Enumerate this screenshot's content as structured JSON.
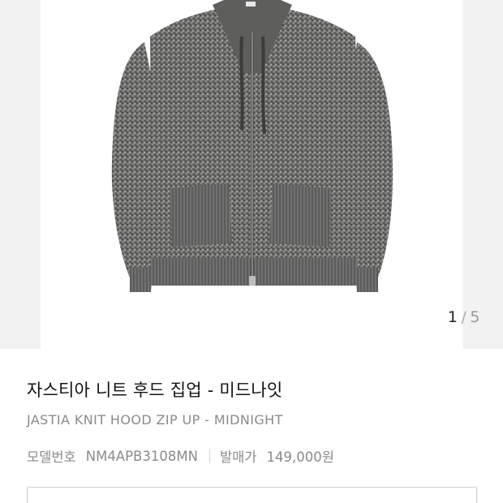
{
  "gallery": {
    "pager": {
      "current": "1",
      "separator": "/",
      "total": "5"
    },
    "image_alt": "jastia-knit-hood-zip-up"
  },
  "product": {
    "title": "자스티아 니트 후드 집업 - 미드나잇",
    "subtitle": "JASTIA KNIT HOOD ZIP UP - MIDNIGHT",
    "model_label": "모델번호",
    "model_value": "NM4APB3108MN",
    "price_label": "발매가",
    "price_value": "149,000원"
  },
  "colors": {
    "knit_base": "#6f706e",
    "knit_dark": "#4b4c4a",
    "knit_light": "#a3a4a1"
  }
}
